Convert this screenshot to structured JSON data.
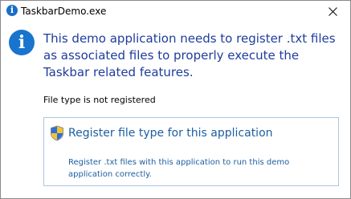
{
  "window": {
    "title": "TaskbarDemo.exe",
    "title_icon_glyph": "i",
    "close_glyph": "close-icon"
  },
  "dialog": {
    "icon_glyph": "i",
    "icon_name": "info-icon",
    "main_instruction": "This demo application needs to register .txt files as associated files to properly execute the Taskbar related features.",
    "content": "File type is not registered",
    "command_link": {
      "icon_name": "uac-shield-icon",
      "title": "Register file type for this application",
      "description": "Register .txt files with this application to run this demo application correctly."
    }
  },
  "colors": {
    "accent": "#1874cd",
    "instruction_text": "#1e3c9e",
    "link_text": "#1d5fa0",
    "link_border": "#a9c6e5"
  }
}
